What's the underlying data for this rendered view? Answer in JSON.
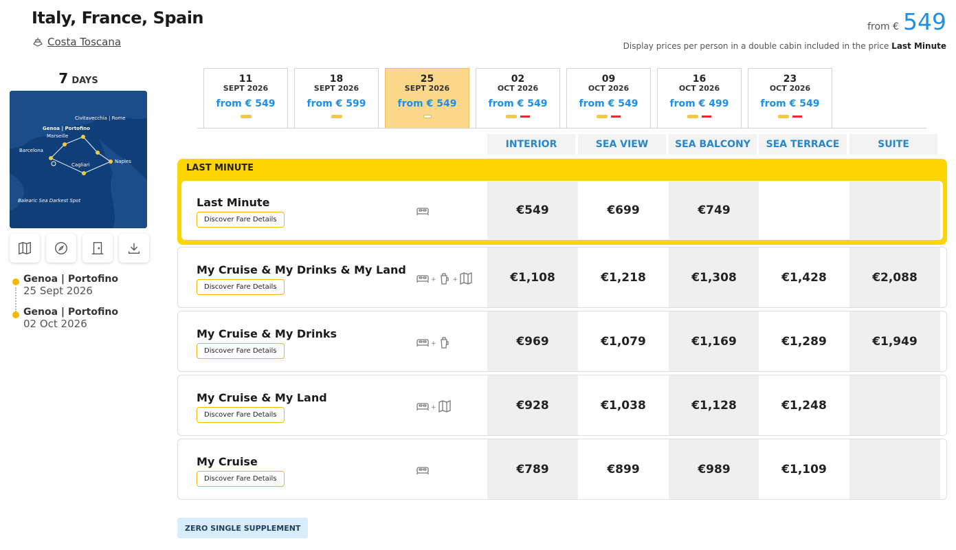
{
  "header": {
    "title": "Italy, France, Spain",
    "ship": "Costa Toscana",
    "from_label": "from €",
    "from_value": "549",
    "price_note_prefix": "Display prices per person in a double cabin included in the price",
    "price_note_bold": "Last Minute"
  },
  "itinerary": {
    "days_num": "7",
    "days_label": "DAYS",
    "map_labels": [
      "Civitavecchia | Rome",
      "Genoa | Portofino",
      "Marseille",
      "Barcelona",
      "Cagliari",
      "Naples",
      "Balearic Sea Darkest Spot"
    ],
    "tools": [
      "map-icon",
      "compass-icon",
      "door-icon",
      "download-icon"
    ],
    "stops": [
      {
        "port": "Genoa | Portofino",
        "date": "25 Sept 2026"
      },
      {
        "port": "Genoa | Portofino",
        "date": "02 Oct 2026"
      }
    ]
  },
  "dates": [
    {
      "day": "11",
      "month": "SEPT 2026",
      "price": "from € 549",
      "marks": [
        "y"
      ]
    },
    {
      "day": "18",
      "month": "SEPT 2026",
      "price": "from € 599",
      "marks": [
        "y"
      ]
    },
    {
      "day": "25",
      "month": "SEPT 2026",
      "price": "from € 549",
      "marks": [
        "w"
      ],
      "active": true
    },
    {
      "day": "02",
      "month": "OCT 2026",
      "price": "from € 549",
      "marks": [
        "y",
        "r"
      ]
    },
    {
      "day": "09",
      "month": "OCT 2026",
      "price": "from € 549",
      "marks": [
        "y",
        "r"
      ]
    },
    {
      "day": "16",
      "month": "OCT 2026",
      "price": "from € 499",
      "marks": [
        "y",
        "r"
      ]
    },
    {
      "day": "23",
      "month": "OCT 2026",
      "price": "from € 549",
      "marks": [
        "y",
        "r"
      ]
    }
  ],
  "columns": [
    "INTERIOR",
    "SEA VIEW",
    "SEA BALCONY",
    "SEA TERRACE",
    "SUITE"
  ],
  "last_minute_label": "LAST MINUTE",
  "discover_label": "Discover Fare Details",
  "fares": [
    {
      "name": "Last Minute",
      "icons": [
        "bed-icon"
      ],
      "prices": [
        "€549",
        "€699",
        "€749",
        "",
        ""
      ]
    },
    {
      "name": "My Cruise & My Drinks & My Land",
      "icons": [
        "bed-icon",
        "drink-icon",
        "land-map-icon"
      ],
      "prices": [
        "€1,108",
        "€1,218",
        "€1,308",
        "€1,428",
        "€2,088"
      ]
    },
    {
      "name": "My Cruise & My Drinks",
      "icons": [
        "bed-icon",
        "drink-icon"
      ],
      "prices": [
        "€969",
        "€1,079",
        "€1,169",
        "€1,289",
        "€1,949"
      ]
    },
    {
      "name": "My Cruise & My Land",
      "icons": [
        "bed-icon",
        "land-map-icon"
      ],
      "prices": [
        "€928",
        "€1,038",
        "€1,128",
        "€1,248",
        ""
      ]
    },
    {
      "name": "My Cruise",
      "icons": [
        "bed-icon"
      ],
      "prices": [
        "€789",
        "€899",
        "€989",
        "€1,109",
        ""
      ]
    }
  ],
  "badge": "ZERO SINGLE SUPPLEMENT",
  "colors": {
    "accent": "#1e8ee6",
    "last_minute": "#ffd500",
    "column_header": "#2a86c8"
  }
}
